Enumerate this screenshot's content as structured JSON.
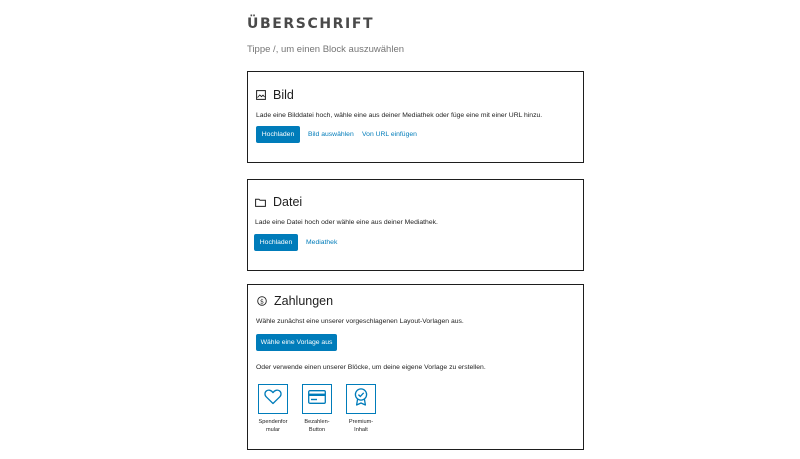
{
  "heading": "ÜBERSCHRIFT",
  "hint": "Tippe /, um einen Block auszuwählen",
  "bild": {
    "title": "Bild",
    "icon": "image-icon",
    "description": "Lade eine Bilddatei hoch, wähle eine aus deiner Mediathek oder füge eine mit einer URL hinzu.",
    "upload_label": "Hochladen",
    "select_label": "Bild auswählen",
    "url_label": "Von URL einfügen"
  },
  "datei": {
    "title": "Datei",
    "icon": "folder-icon",
    "description": "Lade eine Datei hoch oder wähle eine aus deiner Mediathek.",
    "upload_label": "Hochladen",
    "library_label": "Mediathek"
  },
  "zahlungen": {
    "title": "Zahlungen",
    "icon": "dollar-circle-icon",
    "description": "Wähle zunächst eine unserer vorgeschlagenen Layout-Vorlagen aus.",
    "template_button": "Wähle eine Vorlage aus",
    "or_text": "Oder verwende einen unserer Blöcke, um deine eigene Vorlage zu erstellen.",
    "tiles": [
      {
        "icon": "heart-icon",
        "label_line1": "Spendenfor",
        "label_line2": "mular"
      },
      {
        "icon": "credit-card-icon",
        "label_line1": "Bezahlen-",
        "label_line2": "Button"
      },
      {
        "icon": "award-badge-icon",
        "label_line1": "Premium-",
        "label_line2": "Inhalt"
      }
    ]
  },
  "colors": {
    "accent": "#007cba",
    "text": "#1e1e1e",
    "muted": "#757575"
  }
}
